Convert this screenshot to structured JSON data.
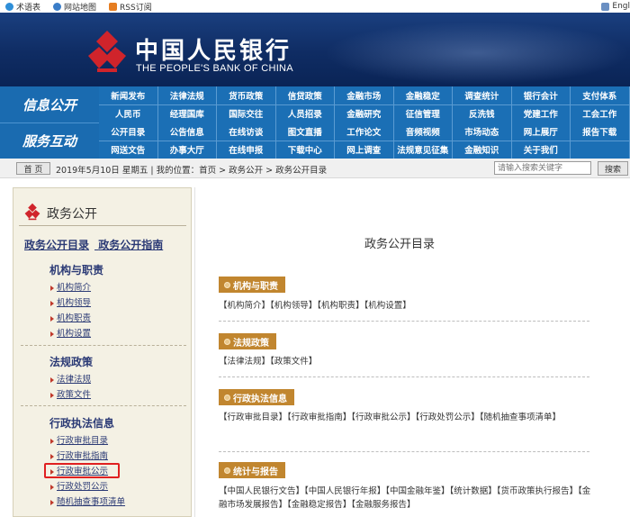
{
  "topbar": {
    "links": [
      "术语表",
      "网站地图",
      "RSS订阅"
    ],
    "right_text": "Engl"
  },
  "brand": {
    "name_cn": "中国人民银行",
    "name_en": "THE PEOPLE'S BANK OF CHINA",
    "colors": {
      "banner": "#0f2c63",
      "nav": "#1b6fb5",
      "logo": "#d0242b",
      "tag": "#c1862f",
      "highlight": "#e02020"
    }
  },
  "nav": {
    "section1": "信息公开",
    "section2": "服务互动",
    "rows": [
      [
        "新闻发布",
        "法律法规",
        "货币政策",
        "信贷政策",
        "金融市场",
        "金融稳定",
        "调查统计",
        "银行会计",
        "支付体系"
      ],
      [
        "人民币",
        "经理国库",
        "国际交往",
        "人员招录",
        "金融研究",
        "征信管理",
        "反洗钱",
        "党建工作",
        "工会工作"
      ],
      [
        "公开目录",
        "公告信息",
        "在线访谈",
        "图文直播",
        "工作论文",
        "音频视频",
        "市场动态",
        "网上展厅",
        "报告下载"
      ],
      [
        "网送文告",
        "办事大厅",
        "在线申报",
        "下载中心",
        "网上调查",
        "法规意见征集",
        "金融知识",
        "关于我们",
        ""
      ]
    ]
  },
  "infobar": {
    "home": "首 页",
    "date_location": "2019年5月10日 星期五 | 我的位置：首页 > 政务公开 > 政务公开目录",
    "search_placeholder": "请输入搜索关键字",
    "search_button": "搜索"
  },
  "sidebar": {
    "title": "政务公开",
    "top_links": [
      "政务公开目录",
      "政务公开指南"
    ],
    "sections": [
      {
        "heading": "机构与职责",
        "items": [
          "机构简介",
          "机构领导",
          "机构职责",
          "机构设置"
        ]
      },
      {
        "heading": "法规政策",
        "items": [
          "法律法规",
          "政策文件"
        ]
      },
      {
        "heading": "行政执法信息",
        "items": [
          "行政审批目录",
          "行政审批指南",
          "行政审批公示",
          "行政处罚公示",
          "随机抽查事项清单"
        ]
      }
    ]
  },
  "main": {
    "title": "政务公开目录",
    "blocks": [
      {
        "tag": "机构与职责",
        "links": "【机构简介】【机构领导】【机构职责】【机构设置】"
      },
      {
        "tag": "法规政策",
        "links": "【法律法规】【政策文件】"
      },
      {
        "tag": "行政执法信息",
        "links": "【行政审批目录】【行政审批指南】【行政审批公示】【行政处罚公示】【随机抽查事项清单】"
      },
      {
        "tag": "统计与报告",
        "links": "【中国人民银行文告】【中国人民银行年报】【中国金融年鉴】【统计数据】【货币政策执行报告】【金融市场发展报告】【金融稳定报告】【金融服务报告】"
      }
    ]
  }
}
